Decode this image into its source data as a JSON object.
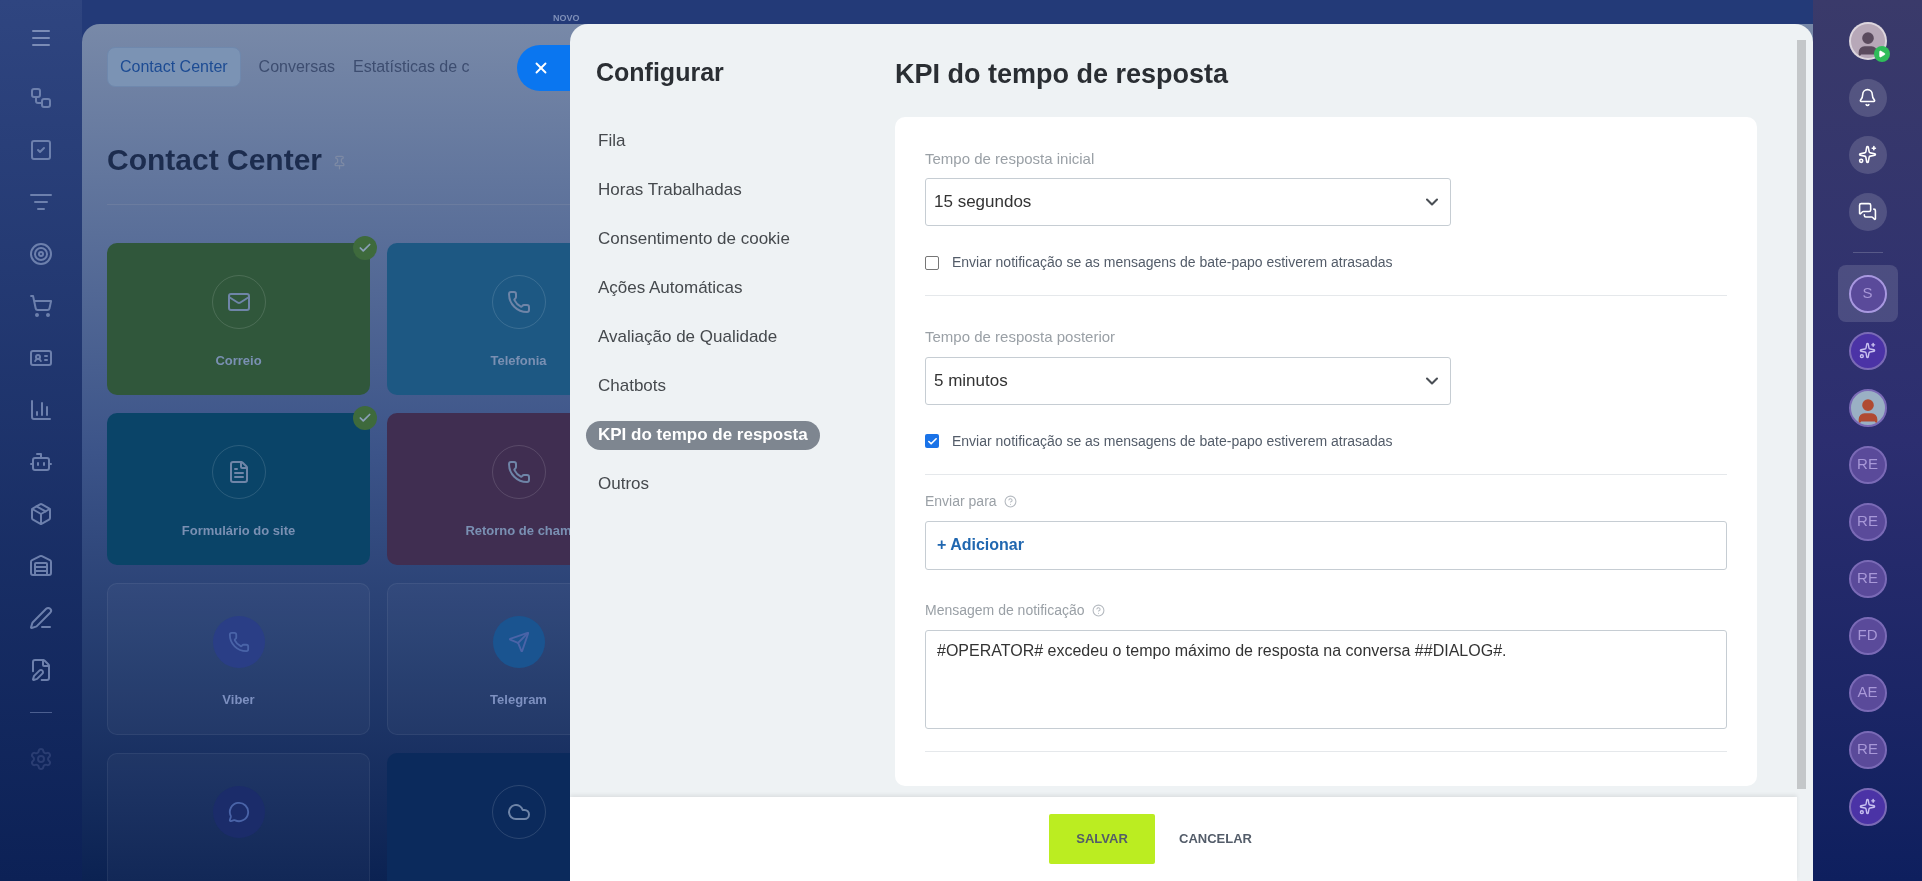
{
  "background_page": {
    "badge": "NOVO",
    "tabs": [
      {
        "label": "Contact Center",
        "selected": true
      },
      {
        "label": "Conversas",
        "selected": false
      },
      {
        "label": "Estatísticas de c",
        "selected": false
      }
    ],
    "title": "Contact Center",
    "tiles": [
      {
        "kind": "filled",
        "label": "Correio",
        "checked": true,
        "color": "#30573b"
      },
      {
        "kind": "filled",
        "label": "Telefonia",
        "checked": false,
        "color": "#1d5883"
      },
      {
        "kind": "filled",
        "label": "Formulário do site",
        "checked": true,
        "color": "#0a4468"
      },
      {
        "kind": "filled",
        "label": "Retorno de cham",
        "checked": false,
        "color": "#402e51"
      },
      {
        "kind": "plain",
        "label": "Viber",
        "color": "#2a3e86"
      },
      {
        "kind": "plain",
        "label": "Telegram",
        "color": "#1a5490"
      },
      {
        "kind": "plain",
        "color": "#1b2c6a"
      },
      {
        "kind": "filled",
        "color": "#0b2a5c"
      }
    ]
  },
  "settings": {
    "title": "Configurar",
    "menu": [
      {
        "label": "Fila",
        "selected": false
      },
      {
        "label": "Horas Trabalhadas",
        "selected": false
      },
      {
        "label": "Consentimento de cookie",
        "selected": false
      },
      {
        "label": "Ações Automáticas",
        "selected": false
      },
      {
        "label": "Avaliação de Qualidade",
        "selected": false
      },
      {
        "label": "Chatbots",
        "selected": false
      },
      {
        "label": "KPI do tempo de resposta",
        "selected": true
      },
      {
        "label": "Outros",
        "selected": false
      }
    ]
  },
  "kpi": {
    "title": "KPI do tempo de resposta",
    "sections": [
      {
        "label": "Tempo de resposta inicial",
        "value": "15 segundos",
        "notify": {
          "label": "Enviar notificação se as mensagens de bate-papo estiverem atrasadas",
          "checked": false
        }
      },
      {
        "label": "Tempo de resposta posterior",
        "value": "5 minutos",
        "notify": {
          "label": "Enviar notificação se as mensagens de bate-papo estiverem atrasadas",
          "checked": true
        }
      }
    ],
    "send_to": {
      "label": "Enviar para",
      "button": "+ Adicionar"
    },
    "message": {
      "label": "Mensagem de notificação",
      "value": "#OPERATOR# excedeu o tempo máximo de resposta na conversa ##DIALOG#."
    }
  },
  "footer": {
    "save": "SALVAR",
    "cancel": "CANCELAR"
  },
  "right_bar": [
    {
      "kind": "avatar"
    },
    {
      "kind": "bell"
    },
    {
      "kind": "copilot"
    },
    {
      "kind": "chat"
    },
    {
      "kind": "divider"
    },
    {
      "kind": "initials",
      "text": "S",
      "selected": true
    },
    {
      "kind": "copilot_chat",
      "selected": false
    },
    {
      "kind": "chat_avatar",
      "selected": false
    },
    {
      "kind": "initials",
      "text": "RE",
      "selected": false
    },
    {
      "kind": "initials",
      "text": "RE",
      "selected": false
    },
    {
      "kind": "initials",
      "text": "RE",
      "selected": false
    },
    {
      "kind": "initials",
      "text": "FD",
      "selected": false
    },
    {
      "kind": "initials",
      "text": "AE",
      "selected": false
    },
    {
      "kind": "initials",
      "text": "RE",
      "selected": false
    },
    {
      "kind": "copilot_chat",
      "selected": false
    }
  ]
}
